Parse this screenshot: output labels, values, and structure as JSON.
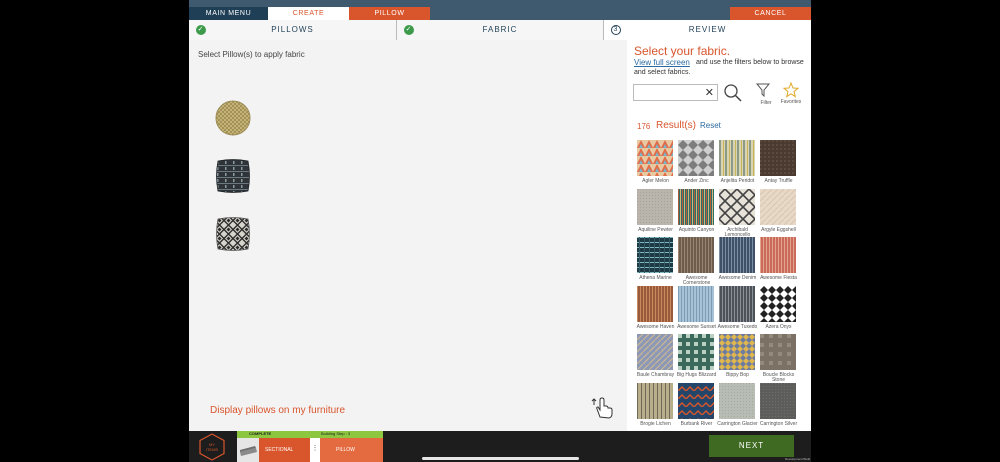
{
  "topbar": {
    "main_menu": "MAIN MENU",
    "create": "CREATE",
    "pillow": "PILLOW",
    "cancel": "CANCEL"
  },
  "steps": [
    {
      "label": "PILLOWS",
      "status": "complete"
    },
    {
      "label": "FABRIC",
      "status": "complete"
    },
    {
      "label": "REVIEW",
      "status": "pending",
      "number": "3"
    }
  ],
  "left": {
    "instruction": "Select Pillow(s) to apply fabric",
    "display_link": "Display pillows on my furniture"
  },
  "right": {
    "title": "Select your fabric.",
    "view_full": "View full screen",
    "filter_text": "and use the filters below to browse and select fabrics.",
    "search_value": "",
    "clear": "✕",
    "filter_label": "Filter",
    "favorites_label": "Favorites",
    "results_count": "176",
    "results_label": "Result(s)",
    "reset": "Reset"
  },
  "fabrics": [
    {
      "name": "Agler Melon"
    },
    {
      "name": "Ander Zinc"
    },
    {
      "name": "Anjelita Peridot"
    },
    {
      "name": "Antay Truffle"
    },
    {
      "name": "Aquiline Pewter"
    },
    {
      "name": "Aquinto Canyon"
    },
    {
      "name": "Archibald Lemoncello"
    },
    {
      "name": "Argyle Eggshell"
    },
    {
      "name": "Athena Marine"
    },
    {
      "name": "Awesome Cornerstone"
    },
    {
      "name": "Awesome Denim"
    },
    {
      "name": "Awesome Fiesta"
    },
    {
      "name": "Awesome Haven"
    },
    {
      "name": "Awesome Sunset"
    },
    {
      "name": "Awesome Tuxedo"
    },
    {
      "name": "Azera Onyx"
    },
    {
      "name": "Baule Chambray"
    },
    {
      "name": "Big Hugs Blizzard"
    },
    {
      "name": "Bippy Bop"
    },
    {
      "name": "Boucle Blocks Stone"
    },
    {
      "name": "Brogie Lichen"
    },
    {
      "name": "Burbank River"
    },
    {
      "name": "Carrington Glacier"
    },
    {
      "name": "Carrington Silver"
    }
  ],
  "bottom": {
    "my_items": "MY ITEMS",
    "complete": "COMPLETE",
    "building_step": "Building Step : 3",
    "sectional": "SECTIONAL",
    "divider": "⋮",
    "pillow": "PILLOW",
    "next": "NEXT",
    "dev": "Development Build"
  },
  "colors": {
    "accent": "#d9552c",
    "navy": "#1f3f56",
    "link": "#2b6aa1",
    "green": "#3e6a21",
    "progress": "#8dc63f"
  }
}
